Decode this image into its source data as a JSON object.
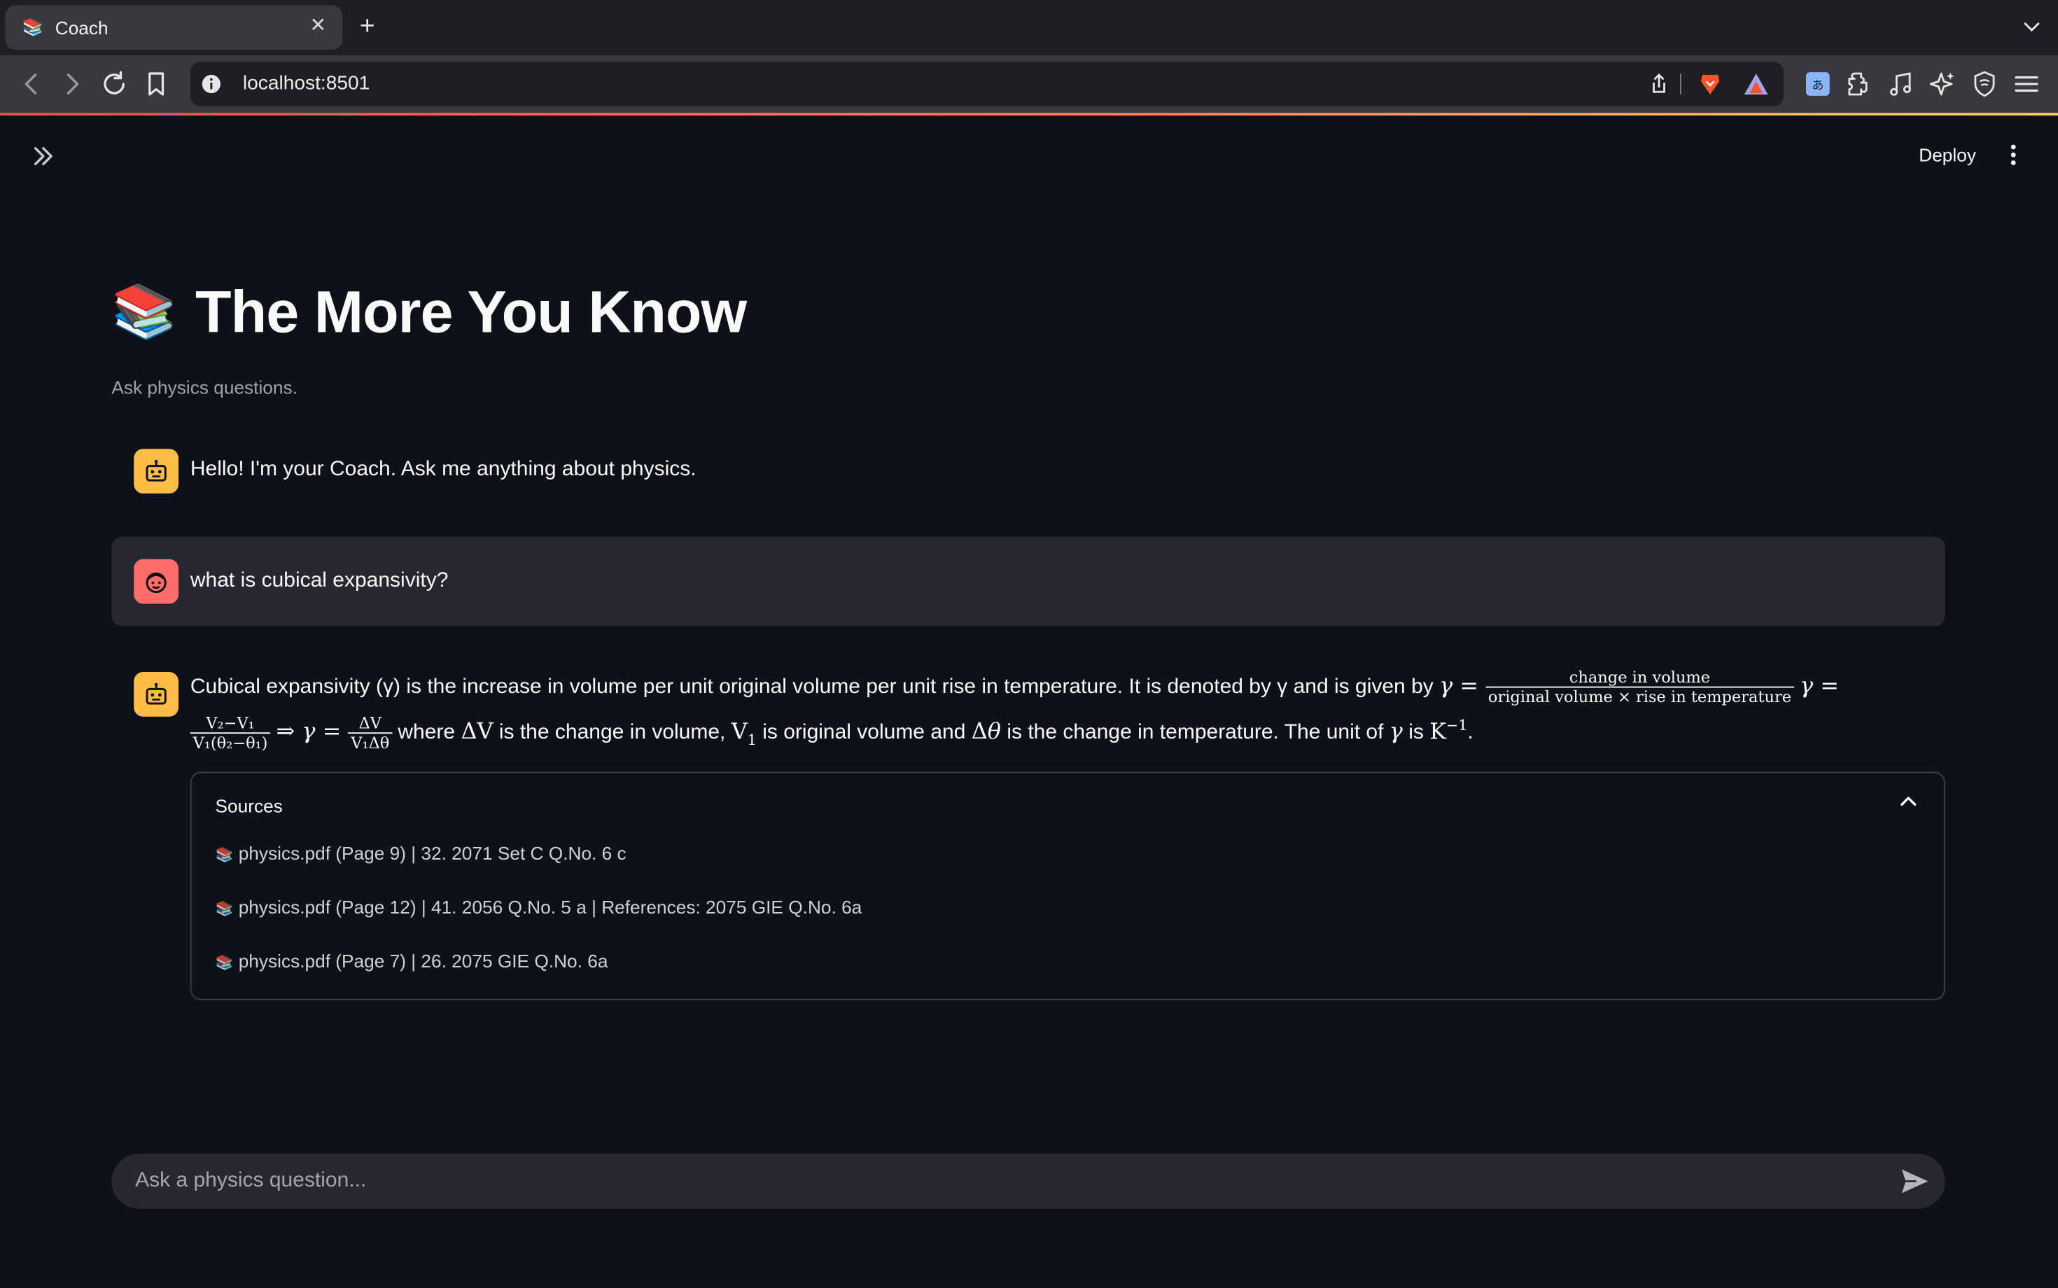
{
  "browser": {
    "tab_title": "Coach",
    "tab_favicon": "📚",
    "url": "localhost:8501",
    "icons": [
      "back-icon",
      "forward-icon",
      "reload-icon",
      "bookmark-icon",
      "site-info-icon",
      "share-icon",
      "brave-shields-icon",
      "brave-rewards-icon",
      "translate-extension-icon",
      "extensions-icon",
      "media-icon",
      "leo-ai-icon",
      "vpn-icon",
      "menu-icon"
    ]
  },
  "app": {
    "deploy_label": "Deploy",
    "title_emoji": "📚",
    "title": "The More You Know",
    "caption": "Ask physics questions."
  },
  "messages": {
    "greeting": "Hello! I'm your Coach. Ask me anything about physics.",
    "user_question": "what is cubical expansivity?",
    "answer": {
      "intro": "Cubical expansivity (γ) is the increase in volume per unit original volume per unit rise in temperature. It is denoted by γ and is given by",
      "frac1_num": "change in volume",
      "frac1_den": "original volume × rise in temperature",
      "frac2_num": "V₂−V₁",
      "frac2_den": "V₁(θ₂−θ₁)",
      "frac3_num": "ΔV",
      "frac3_den": "V₁Δθ",
      "where_text": "where",
      "dv_text": "is the change in volume,",
      "v1_text": "is original volume and",
      "dt_text": "is the change in temperature. The unit of",
      "is_text": "is"
    }
  },
  "sources": {
    "label": "Sources",
    "items": [
      "physics.pdf (Page 9) | 32. 2071 Set C Q.No. 6 c",
      "physics.pdf (Page 12) | 41. 2056 Q.No. 5 a | References: 2075 GIE Q.No. 6a",
      "physics.pdf (Page 7) | 26. 2075 GIE Q.No. 6a"
    ]
  },
  "chat_input": {
    "placeholder": "Ask a physics question..."
  },
  "colors": {
    "background": "#0e1117",
    "bot_avatar": "#ffbd45",
    "user_avatar": "#ff6c6c",
    "input_bg": "#262730"
  }
}
